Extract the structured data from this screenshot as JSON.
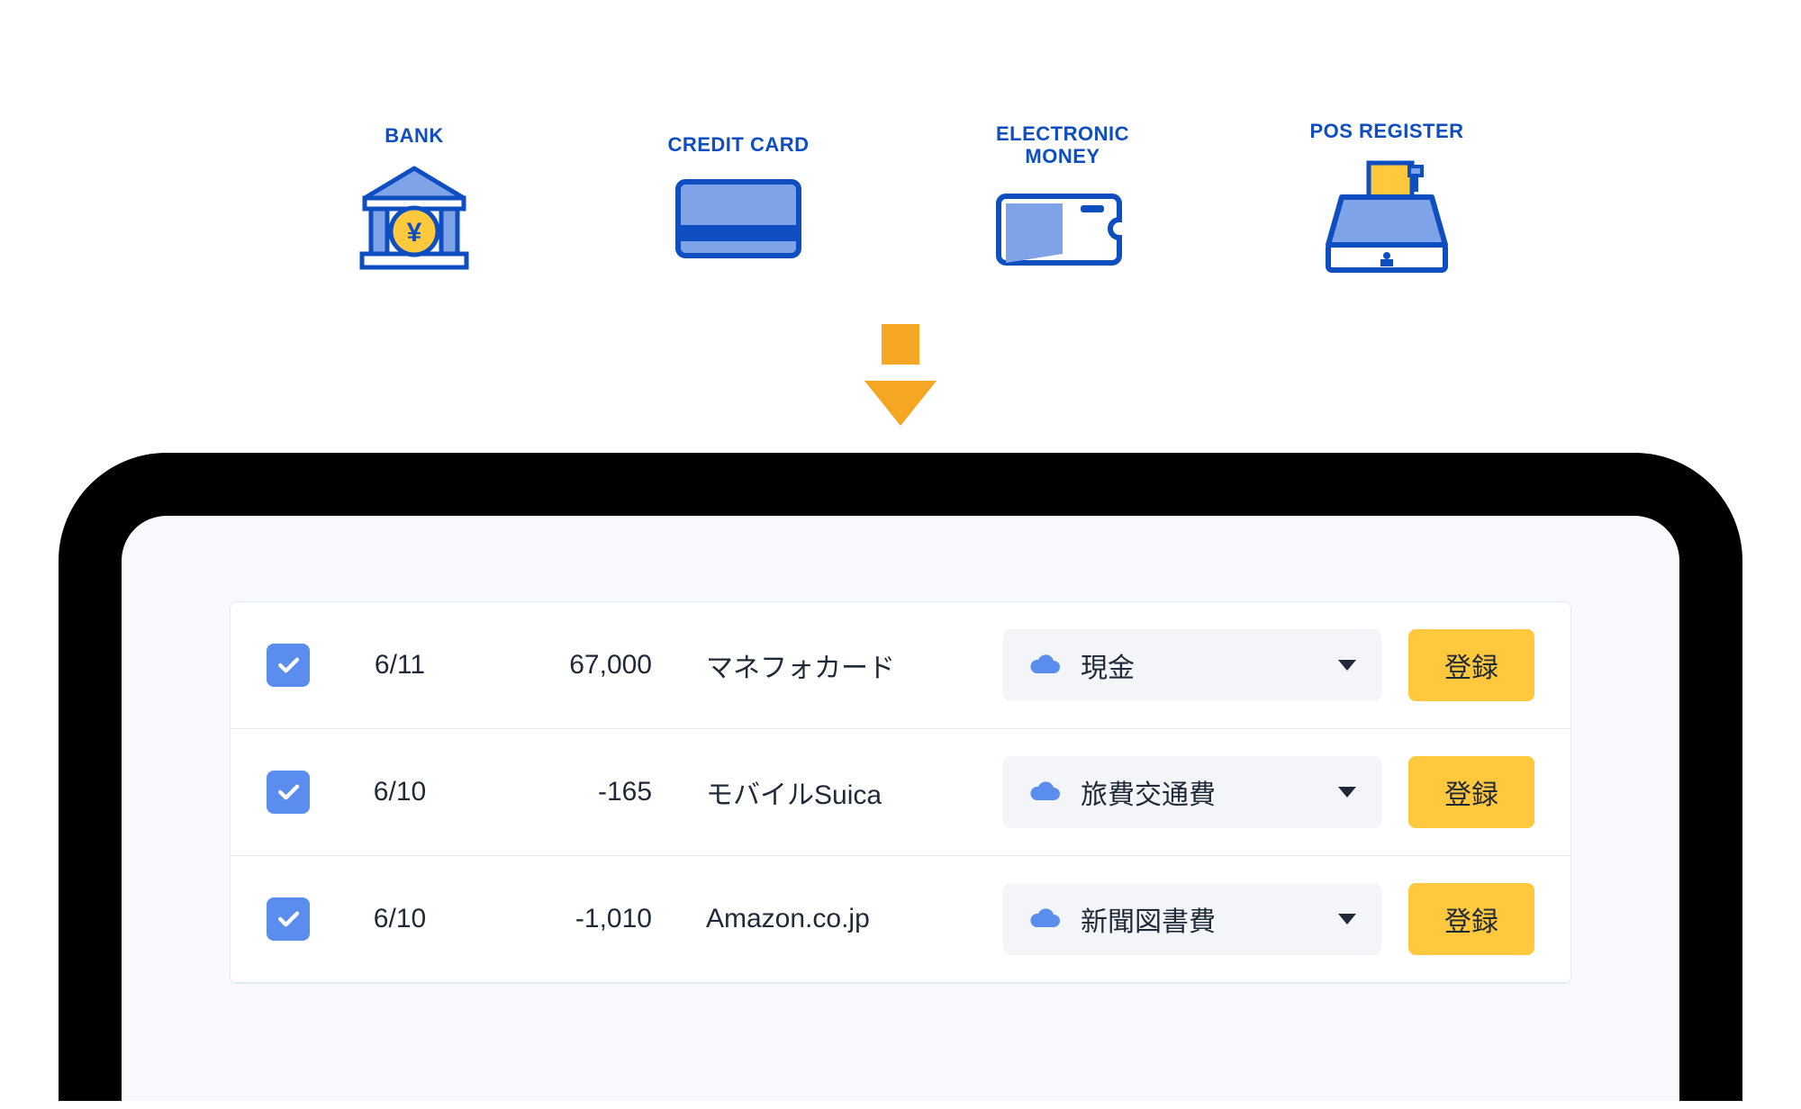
{
  "sources": [
    {
      "label": "BANK"
    },
    {
      "label": "CREDIT CARD"
    },
    {
      "label": "ELECTRONIC\nMONEY"
    },
    {
      "label": "POS REGISTER"
    }
  ],
  "transactions": [
    {
      "date": "6/11",
      "amount": "67,000",
      "description": "マネフォカード",
      "category": "現金",
      "button": "登録"
    },
    {
      "date": "6/10",
      "amount": "-165",
      "description": "モバイルSuica",
      "category": "旅費交通費",
      "button": "登録"
    },
    {
      "date": "6/10",
      "amount": "-1,010",
      "description": "Amazon.co.jp",
      "category": "新聞図書費",
      "button": "登録"
    }
  ],
  "colors": {
    "brand_blue": "#0E4EC1",
    "accent_yellow": "#FFC83D",
    "arrow_orange": "#F5A623",
    "checkbox_blue": "#5B8DEF"
  }
}
